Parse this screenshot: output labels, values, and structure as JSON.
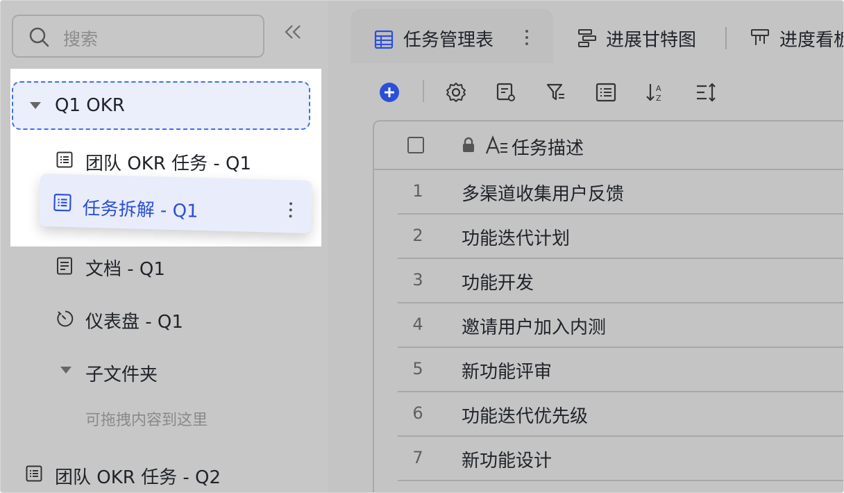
{
  "sidebar": {
    "search_placeholder": "搜索",
    "folder_q1": "Q1 OKR",
    "items": [
      {
        "label": "团队 OKR 任务 - Q1"
      },
      {
        "label": "任务拆解 - Q1"
      },
      {
        "label": "文档 - Q1"
      },
      {
        "label": "仪表盘 - Q1"
      },
      {
        "label": "子文件夹"
      },
      {
        "label": "团队 OKR 任务 - Q2"
      }
    ],
    "drop_hint": "可拖拽内容到这里"
  },
  "tabs": [
    {
      "label": "任务管理表"
    },
    {
      "label": "进展甘特图"
    },
    {
      "label": "进度看板"
    }
  ],
  "table": {
    "column_header": "任务描述",
    "rows": [
      {
        "num": "1",
        "desc": "多渠道收集用户反馈"
      },
      {
        "num": "2",
        "desc": "功能迭代计划"
      },
      {
        "num": "3",
        "desc": "功能开发"
      },
      {
        "num": "4",
        "desc": "邀请用户加入内测"
      },
      {
        "num": "5",
        "desc": "新功能评审"
      },
      {
        "num": "6",
        "desc": "功能迭代优先级"
      },
      {
        "num": "7",
        "desc": "新功能设计"
      }
    ]
  },
  "colors": {
    "accent": "#2b4fd6",
    "dashed_border": "#3b6ef5"
  }
}
